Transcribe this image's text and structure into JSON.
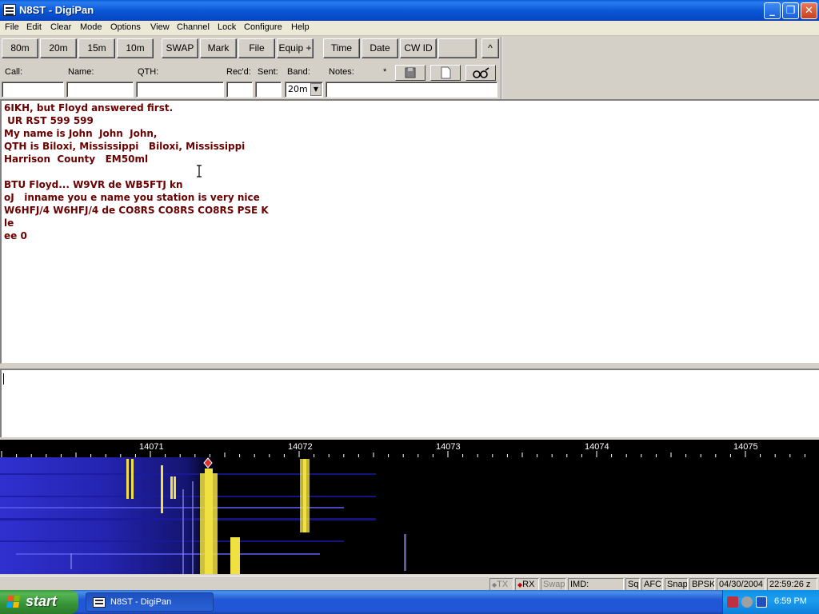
{
  "window": {
    "title": "N8ST - DigiPan"
  },
  "menu": [
    "File",
    "Edit",
    "Clear",
    "Mode",
    "Options",
    "View",
    "Channel",
    "Lock",
    "Configure",
    "Help"
  ],
  "toolbar": {
    "buttons": [
      "80m",
      "20m",
      "15m",
      "10m",
      "SWAP",
      "Mark",
      "File",
      "Equip +",
      "Time",
      "Date",
      "CW ID",
      ""
    ],
    "collapse_glyph": "^"
  },
  "log": {
    "labels": {
      "call": "Call:",
      "name": "Name:",
      "qth": "QTH:",
      "recd": "Rec'd:",
      "sent": "Sent:",
      "band": "Band:",
      "notes": "Notes:",
      "asterisk": "*"
    },
    "values": {
      "call": "",
      "name": "",
      "qth": "",
      "recd": "",
      "sent": "",
      "band": "20m",
      "notes": ""
    }
  },
  "rx_text": [
    "6IKH, but Floyd answered first.",
    " UR RST 599 599",
    "My name is John  John  John,",
    "QTH is Biloxi, Mississippi   Biloxi, Mississippi",
    "Harrison  County   EM50ml",
    "",
    "BTU Floyd... W9VR de WB5FTJ kn",
    "oJ   inname you e name you station is very nice",
    "W6HFJ/4 W6HFJ/4 de CO8RS CO8RS CO8RS PSE K",
    "le",
    "ee 0"
  ],
  "tx_text": "",
  "waterfall": {
    "freq_labels": [
      "14071",
      "14072",
      "14073",
      "14074",
      "14075"
    ],
    "colors": {
      "background": "#000000",
      "low": "#1a1aa0",
      "mid": "#3232d8",
      "signal": "#f0e040",
      "marker": "#e03030"
    }
  },
  "status": {
    "tx": "TX",
    "rx": "RX",
    "swap": "Swap",
    "imd": "IMD:",
    "sq": "Sq",
    "afc": "AFC",
    "snap": "Snap",
    "mode": "BPSK",
    "date": "04/30/2004",
    "time": "22:59:26 z"
  },
  "taskbar": {
    "start": "start",
    "task": "N8ST - DigiPan",
    "clock": "6:59 PM"
  },
  "colors": {
    "rx_text": "#6a0000",
    "title_bar": "#0a58d6",
    "taskbar": "#2157d7",
    "start": "#369336"
  }
}
